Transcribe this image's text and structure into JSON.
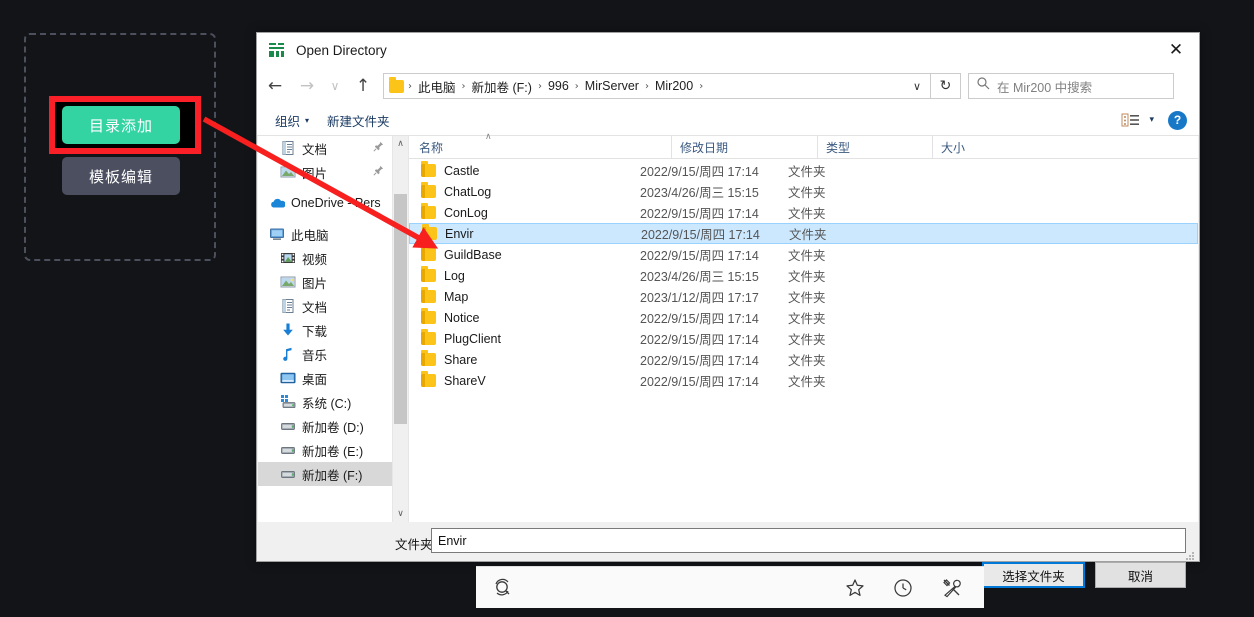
{
  "app_panel": {
    "buttons": [
      {
        "label": "目录添加",
        "name": "directory-add-button",
        "highlighted": true
      },
      {
        "label": "模板编辑",
        "name": "template-edit-button",
        "highlighted": false
      }
    ],
    "colors": {
      "primary": "#34d3a2",
      "secondary": "#4b4f5f",
      "highlight": "#fb1f27",
      "panel_bg": "#121418"
    }
  },
  "dialog": {
    "title": "Open Directory",
    "title_icon": "app-icon",
    "close_label": "✕",
    "nav": {
      "back_icon": "←",
      "forward_icon": "→",
      "recent_icon": "∨",
      "up_icon": "↑",
      "breadcrumb": [
        "此电脑",
        "新加卷 (F:)",
        "996",
        "MirServer",
        "Mir200"
      ],
      "breadcrumb_separator": "›",
      "dropdown_icon": "∨",
      "refresh_icon": "↻"
    },
    "search": {
      "placeholder": "在 Mir200 中搜索",
      "icon": "search-icon"
    },
    "toolbar": {
      "organize_label": "组织",
      "organize_caret": "▾",
      "new_folder_label": "新建文件夹",
      "view_caret": "▾",
      "help_label": "?"
    },
    "nav_pane": {
      "items": [
        {
          "label": "文档",
          "icon": "document-icon",
          "indent": 1,
          "pinned": true,
          "selected": false
        },
        {
          "label": "图片",
          "icon": "picture-icon",
          "indent": 1,
          "pinned": true,
          "selected": false
        },
        {
          "label": "OneDrive - Pers",
          "icon": "onedrive-icon",
          "indent": 0,
          "pinned": false,
          "selected": false
        },
        {
          "label": "此电脑",
          "icon": "computer-icon",
          "indent": 0,
          "pinned": false,
          "selected": false
        },
        {
          "label": "视频",
          "icon": "video-icon",
          "indent": 1,
          "pinned": false,
          "selected": false
        },
        {
          "label": "图片",
          "icon": "picture-icon",
          "indent": 1,
          "pinned": false,
          "selected": false
        },
        {
          "label": "文档",
          "icon": "document-icon",
          "indent": 1,
          "pinned": false,
          "selected": false
        },
        {
          "label": "下载",
          "icon": "download-icon",
          "indent": 1,
          "pinned": false,
          "selected": false
        },
        {
          "label": "音乐",
          "icon": "music-icon",
          "indent": 1,
          "pinned": false,
          "selected": false
        },
        {
          "label": "桌面",
          "icon": "desktop-icon",
          "indent": 1,
          "pinned": false,
          "selected": false
        },
        {
          "label": "系统 (C:)",
          "icon": "system-drive-icon",
          "indent": 1,
          "pinned": false,
          "selected": false
        },
        {
          "label": "新加卷 (D:)",
          "icon": "drive-icon",
          "indent": 1,
          "pinned": false,
          "selected": false
        },
        {
          "label": "新加卷 (E:)",
          "icon": "drive-icon",
          "indent": 1,
          "pinned": false,
          "selected": false
        },
        {
          "label": "新加卷 (F:)",
          "icon": "drive-icon",
          "indent": 1,
          "pinned": false,
          "selected": true
        }
      ],
      "scroll_up_icon": "∧",
      "scroll_down_icon": "∨"
    },
    "file_list": {
      "columns": [
        "名称",
        "修改日期",
        "类型",
        "大小"
      ],
      "sort_indicator": "∧",
      "rows": [
        {
          "name": "Castle",
          "modified": "2022/9/15/周四 17:14",
          "type": "文件夹",
          "size": "",
          "selected": false
        },
        {
          "name": "ChatLog",
          "modified": "2023/4/26/周三 15:15",
          "type": "文件夹",
          "size": "",
          "selected": false
        },
        {
          "name": "ConLog",
          "modified": "2022/9/15/周四 17:14",
          "type": "文件夹",
          "size": "",
          "selected": false
        },
        {
          "name": "Envir",
          "modified": "2022/9/15/周四 17:14",
          "type": "文件夹",
          "size": "",
          "selected": true
        },
        {
          "name": "GuildBase",
          "modified": "2022/9/15/周四 17:14",
          "type": "文件夹",
          "size": "",
          "selected": false
        },
        {
          "name": "Log",
          "modified": "2023/4/26/周三 15:15",
          "type": "文件夹",
          "size": "",
          "selected": false
        },
        {
          "name": "Map",
          "modified": "2023/1/12/周四 17:17",
          "type": "文件夹",
          "size": "",
          "selected": false
        },
        {
          "name": "Notice",
          "modified": "2022/9/15/周四 17:14",
          "type": "文件夹",
          "size": "",
          "selected": false
        },
        {
          "name": "PlugClient",
          "modified": "2022/9/15/周四 17:14",
          "type": "文件夹",
          "size": "",
          "selected": false
        },
        {
          "name": "Share",
          "modified": "2022/9/15/周四 17:14",
          "type": "文件夹",
          "size": "",
          "selected": false
        },
        {
          "name": "ShareV",
          "modified": "2022/9/15/周四 17:14",
          "type": "文件夹",
          "size": "",
          "selected": false
        }
      ]
    },
    "footer": {
      "folder_label": "文件夹:",
      "folder_value": "Envir",
      "accept_label": "选择文件夹",
      "cancel_label": "取消"
    }
  },
  "taskbar": {
    "left_icon": "search-refresh-icon",
    "right_icons": [
      "star-icon",
      "clock-icon",
      "tools-icon"
    ]
  }
}
